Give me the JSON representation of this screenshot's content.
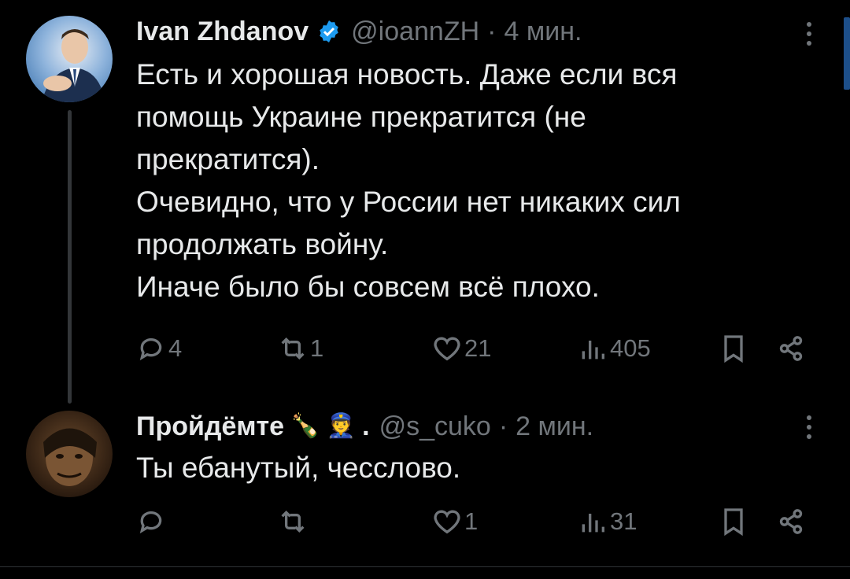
{
  "tweets": [
    {
      "author_name": "Ivan Zhdanov",
      "verified": true,
      "handle": "@ioannZH",
      "separator": "·",
      "time": "4 мин.",
      "lines": [
        "Есть и хорошая новость. Даже если вся",
        "помощь Украине прекратится (не",
        "прекратится).",
        "Очевидно, что у России нет никаких сил",
        "продолжать войну.",
        "Иначе было бы совсем всё плохо."
      ],
      "replies": "4",
      "retweets": "1",
      "likes": "21",
      "views": "405"
    },
    {
      "author_name": "Пройдёмте",
      "name_emojis": "🍾 👮",
      "name_suffix": ".",
      "verified": false,
      "handle": "@s_cuko",
      "separator": "·",
      "time": "2 мин.",
      "lines": [
        "Ты ебанутый, чесслово."
      ],
      "replies": "",
      "retweets": "",
      "likes": "1",
      "views": "31"
    }
  ],
  "icons": {
    "reply": "reply-icon",
    "retweet": "retweet-icon",
    "like": "heart-icon",
    "views": "views-icon",
    "bookmark": "bookmark-icon",
    "share": "share-icon",
    "more": "more-vertical-icon",
    "verified": "verified-badge-icon"
  },
  "colors": {
    "background": "#000000",
    "text": "#e7e9ea",
    "muted": "#71767b",
    "verified": "#1d9bf0",
    "thread_line": "#333639"
  }
}
